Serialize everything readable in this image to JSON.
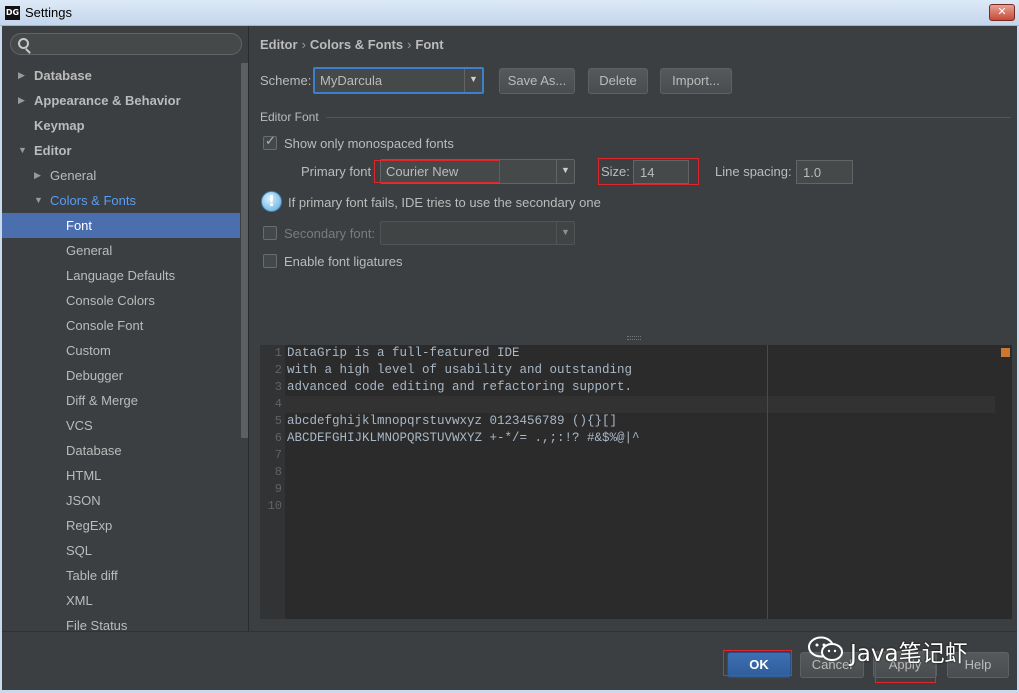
{
  "window": {
    "app_icon": "DG",
    "title": "Settings",
    "close_glyph": "✕"
  },
  "search": {
    "placeholder": "",
    "value": ""
  },
  "sidebar": {
    "items": [
      {
        "label": "Database",
        "level": 0,
        "expanded": false,
        "bold": true
      },
      {
        "label": "Appearance & Behavior",
        "level": 0,
        "expanded": false,
        "bold": true
      },
      {
        "label": "Keymap",
        "level": 0,
        "bold": true
      },
      {
        "label": "Editor",
        "level": 0,
        "expanded": true,
        "bold": true
      },
      {
        "label": "General",
        "level": 1,
        "expanded": false
      },
      {
        "label": "Colors & Fonts",
        "level": 1,
        "expanded": true,
        "current": true
      },
      {
        "label": "Font",
        "level": 2,
        "selected": true
      },
      {
        "label": "General",
        "level": 2
      },
      {
        "label": "Language Defaults",
        "level": 2
      },
      {
        "label": "Console Colors",
        "level": 2
      },
      {
        "label": "Console Font",
        "level": 2
      },
      {
        "label": "Custom",
        "level": 2
      },
      {
        "label": "Debugger",
        "level": 2
      },
      {
        "label": "Diff & Merge",
        "level": 2
      },
      {
        "label": "VCS",
        "level": 2
      },
      {
        "label": "Database",
        "level": 2
      },
      {
        "label": "HTML",
        "level": 2
      },
      {
        "label": "JSON",
        "level": 2
      },
      {
        "label": "RegExp",
        "level": 2
      },
      {
        "label": "SQL",
        "level": 2
      },
      {
        "label": "Table diff",
        "level": 2
      },
      {
        "label": "XML",
        "level": 2
      },
      {
        "label": "File Status",
        "level": 2
      }
    ]
  },
  "breadcrumb": [
    "Editor",
    "Colors & Fonts",
    "Font"
  ],
  "breadcrumb_separator": "›",
  "scheme": {
    "label": "Scheme:",
    "value": "MyDarcula",
    "save_as": "Save As...",
    "delete": "Delete",
    "import": "Import..."
  },
  "editor_font": {
    "section_title": "Editor Font",
    "show_monospaced_label": "Show only monospaced fonts",
    "show_monospaced_checked": true,
    "primary_font_label": "Primary font",
    "primary_font_value": "Courier New",
    "size_label": "Size:",
    "size_value": "14",
    "line_spacing_label": "Line spacing:",
    "line_spacing_value": "1.0",
    "info_icon": "!",
    "info_text": "If primary font fails, IDE tries to use the secondary one",
    "secondary_font_label": "Secondary font:",
    "secondary_font_checked": false,
    "secondary_font_value": "",
    "ligatures_label": "Enable font ligatures",
    "ligatures_checked": false
  },
  "preview": {
    "lines": [
      "DataGrip is a full-featured IDE",
      "with a high level of usability and outstanding",
      "advanced code editing and refactoring support.",
      "",
      "abcdefghijklmnopqrstuvwxyz 0123456789 (){}[]",
      "ABCDEFGHIJKLMNOPQRSTUVWXYZ +-*/= .,;:!? #&$%@|^",
      "",
      "",
      "",
      ""
    ],
    "line_numbers": [
      "1",
      "2",
      "3",
      "4",
      "5",
      "6",
      "7",
      "8",
      "9",
      "10"
    ]
  },
  "footer": {
    "ok": "OK",
    "cancel": "Cancel",
    "apply": "Apply",
    "help": "Help"
  },
  "watermark": {
    "text": "Java笔记虾"
  },
  "colors": {
    "background": "#3c3f41",
    "selection": "#4b6eaf",
    "highlight_box": "#e0262b",
    "editor_bg": "#2b2b2b"
  }
}
